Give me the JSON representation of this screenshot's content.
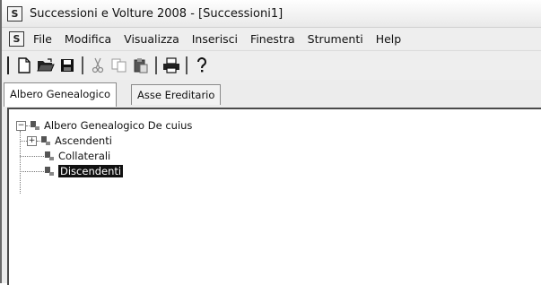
{
  "window": {
    "title": "Successioni e Volture 2008 - [Successioni1]",
    "app_icon_letter": "S"
  },
  "menubar": {
    "icon_letter": "S",
    "items": [
      "File",
      "Modifica",
      "Visualizza",
      "Inserisci",
      "Finestra",
      "Strumenti",
      "Help"
    ]
  },
  "toolbar": {
    "buttons": [
      "new-doc-icon",
      "open-folder-icon",
      "save-disk-icon",
      "cut-scissors-icon",
      "copy-icon",
      "paste-icon",
      "print-icon",
      "help-question-icon"
    ]
  },
  "tabs": [
    {
      "label": "Albero Genealogico",
      "active": true
    },
    {
      "label": "Asse Ereditario",
      "active": false
    }
  ],
  "tree": {
    "root": {
      "label": "Albero Genealogico De cuius",
      "expander": "−"
    },
    "children": [
      {
        "label": "Ascendenti",
        "expander": "+"
      },
      {
        "label": "Collaterali",
        "expander": ""
      },
      {
        "label": "Discendenti",
        "expander": "",
        "selected": true
      }
    ]
  }
}
